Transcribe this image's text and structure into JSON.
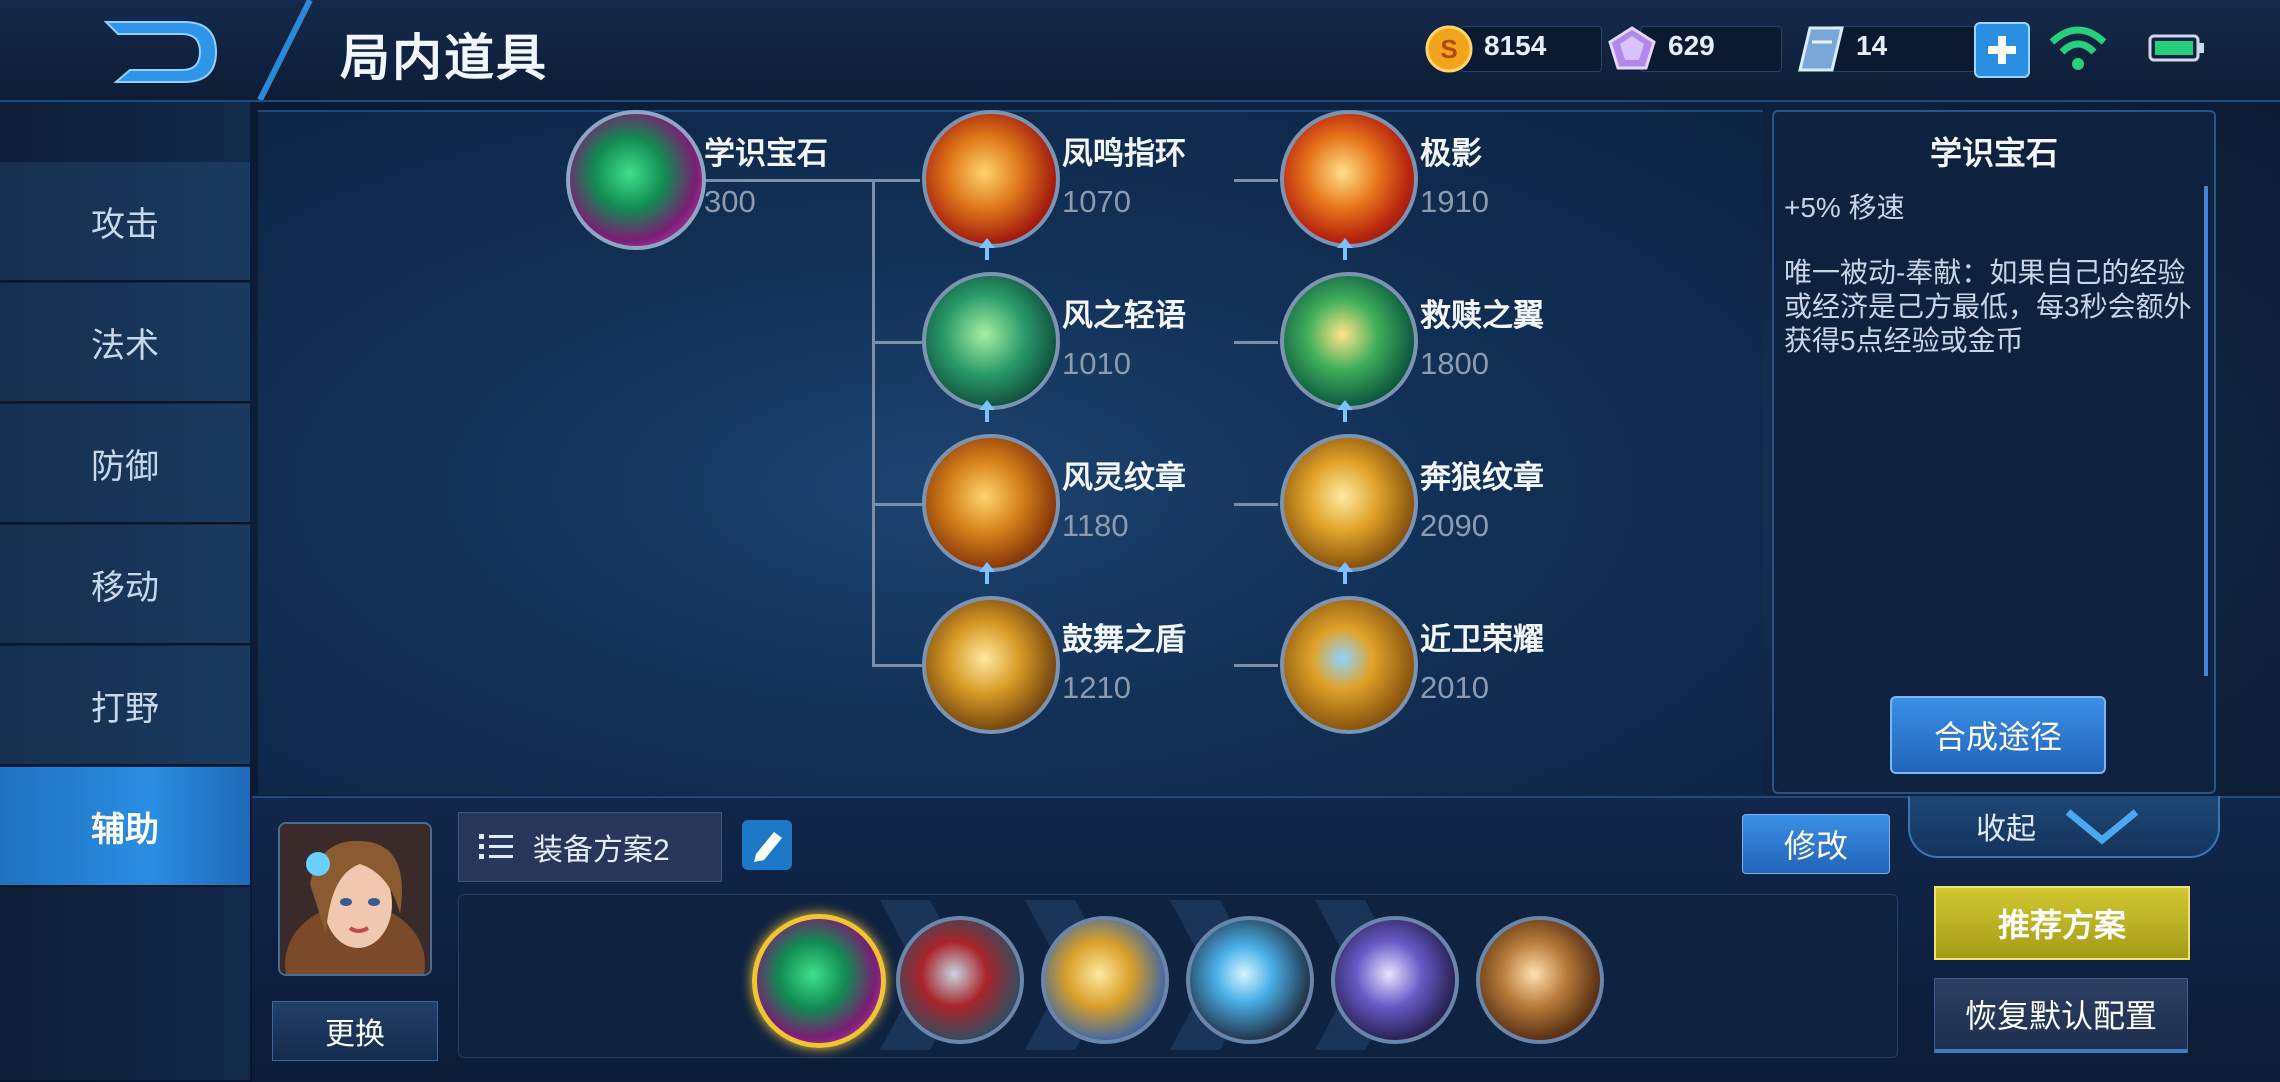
{
  "header": {
    "title": "局内道具",
    "gold": "8154",
    "diamonds": "629",
    "vouchers": "14"
  },
  "sidebar": {
    "items": [
      {
        "label": "攻击"
      },
      {
        "label": "法术"
      },
      {
        "label": "防御"
      },
      {
        "label": "移动"
      },
      {
        "label": "打野"
      },
      {
        "label": "辅助",
        "active": true
      }
    ]
  },
  "tree": {
    "root": {
      "name": "学识宝石",
      "price": "300"
    },
    "items": [
      {
        "name": "凤鸣指环",
        "price": "1070"
      },
      {
        "name": "极影",
        "price": "1910"
      },
      {
        "name": "风之轻语",
        "price": "1010"
      },
      {
        "name": "救赎之翼",
        "price": "1800"
      },
      {
        "name": "风灵纹章",
        "price": "1180"
      },
      {
        "name": "奔狼纹章",
        "price": "2090"
      },
      {
        "name": "鼓舞之盾",
        "price": "1210"
      },
      {
        "name": "近卫荣耀",
        "price": "2010"
      }
    ]
  },
  "detail": {
    "title": "学识宝石",
    "stat": "+5% 移速",
    "description": "唯一被动-奉献：如果自己的经验或经济是己方最低，每3秒会额外获得5点经验或金币",
    "synthesis_button": "合成途径"
  },
  "bottom": {
    "change_button": "更换",
    "plan_label": "装备方案2",
    "modify_button": "修改",
    "collapse_label": "收起",
    "recommend_button": "推荐方案",
    "restore_button": "恢复默认配置"
  },
  "colors": {
    "accent_blue": "#2a8ee2",
    "recommend_yellow": "#d2c832",
    "gold": "#f2a51c",
    "signal_green": "#27d07a"
  }
}
